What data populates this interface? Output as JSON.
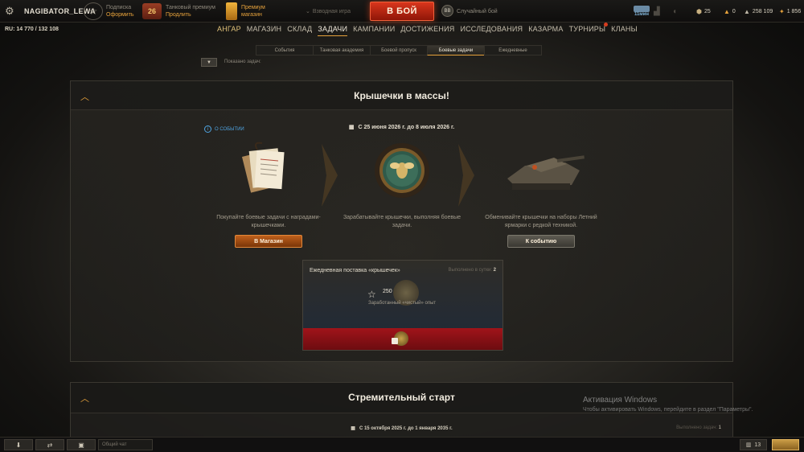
{
  "topbar": {
    "username": "NAGIBATOR_LEWA",
    "subscription": {
      "line1": "Подписка",
      "line2": "Оформить"
    },
    "tank_premium": {
      "days": "26",
      "line1": "Танковый премиум",
      "line2": "Продлить"
    },
    "premium_shop": {
      "line1": "Премиум",
      "line2": "магазин"
    },
    "platoon_label": "Взводная игра",
    "battle_button": "В БОЙ",
    "battle_mode": "Случайный бой",
    "tank_timer": "11мин",
    "currencies": [
      {
        "icon": "bond-icon",
        "value": "25"
      },
      {
        "icon": "gold-icon",
        "value": "0"
      },
      {
        "icon": "credits-icon",
        "value": "258 109"
      },
      {
        "icon": "free-xp-icon",
        "value": "1 856"
      }
    ]
  },
  "rating": "RU: 14 770 / 132 108",
  "nav": [
    "АНГАР",
    "МАГАЗИН",
    "СКЛАД",
    "ЗАДАЧИ",
    "КАМПАНИИ",
    "ДОСТИЖЕНИЯ",
    "ИССЛЕДОВАНИЯ",
    "КАЗАРМА",
    "ТУРНИРЫ",
    "КЛАНЫ"
  ],
  "subtabs": [
    "События",
    "Танковая академия",
    "Боевой пропуск",
    "Боевые задачи",
    "Ежедневные"
  ],
  "filter_label": "Показано задач:",
  "event": {
    "title": "Крышечки в массы!",
    "about": "О СОБЫТИИ",
    "dates": "С 25 июня 2026 г. до 8 июля 2026 г.",
    "col1_desc": "Покупайте боевые задачи с наградами-крышечками.",
    "col1_button": "В Магазин",
    "col2_desc": "Зарабатывайте крышечки, выполняя боевые задачи.",
    "col3_desc": "Обменивайте крышечки на наборы Летний ярмарки с редкой техникой.",
    "col3_button": "К событию"
  },
  "daily": {
    "title": "Ежедневная поставка «крышечек»",
    "limit_label": "Выполнено в сутки:",
    "limit_value": "2",
    "amount": "250",
    "exp_label": "Заработанный «чистый» опыт"
  },
  "event2": {
    "title": "Стремительный старт",
    "dates": "С 15 октября 2025 г. до 1 января 2035 г.",
    "progress_label": "Выполнено задач:",
    "progress_value": "1"
  },
  "watermark": {
    "line1": "Активация Windows",
    "line2": "Чтобы активировать Windows, перейдите в раздел \"Параметры\"."
  },
  "bottombar": {
    "chat_placeholder": "Общий чат",
    "count": "13"
  },
  "colors": {
    "accent": "#e6a23c",
    "battle": "#d9361c",
    "link": "#4fa3e0"
  }
}
